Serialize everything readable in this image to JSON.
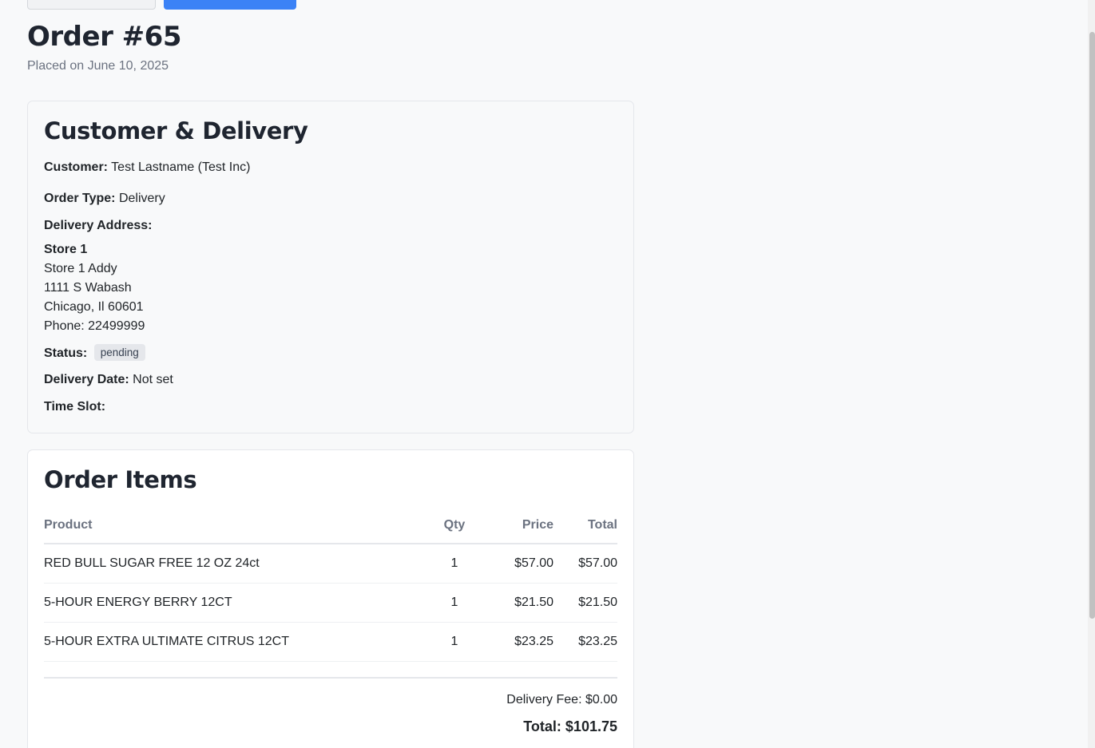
{
  "order": {
    "title": "Order #65",
    "placed_on": "Placed on June 10, 2025"
  },
  "customer_card": {
    "title": "Customer & Delivery",
    "customer_label": "Customer:",
    "customer_value": "Test Lastname (Test Inc)",
    "order_type_label": "Order Type:",
    "order_type_value": "Delivery",
    "address_label": "Delivery Address:",
    "address": {
      "store": "Store 1",
      "line1": "Store 1 Addy",
      "line2": "1111 S Wabash",
      "city": "Chicago, Il 60601",
      "phone": "Phone: 22499999"
    },
    "status_label": "Status:",
    "status_value": "pending",
    "delivery_date_label": "Delivery Date:",
    "delivery_date_value": "Not set",
    "time_slot_label": "Time Slot:"
  },
  "items_card": {
    "title": "Order Items",
    "columns": [
      "Product",
      "Qty",
      "Price",
      "Total"
    ],
    "rows": [
      {
        "product": "RED BULL SUGAR FREE 12 OZ 24ct",
        "qty": "1",
        "price": "$57.00",
        "total": "$57.00"
      },
      {
        "product": "5-HOUR ENERGY BERRY 12CT",
        "qty": "1",
        "price": "$21.50",
        "total": "$21.50"
      },
      {
        "product": "5-HOUR EXTRA ULTIMATE CITRUS 12CT",
        "qty": "1",
        "price": "$23.25",
        "total": "$23.25"
      }
    ],
    "delivery_fee": "Delivery Fee: $0.00",
    "total": "Total: $101.75"
  },
  "colors": {
    "primary_button": "#3b82f6",
    "badge_bg": "#e5e7eb",
    "page_bg": "#f8f9fa"
  }
}
